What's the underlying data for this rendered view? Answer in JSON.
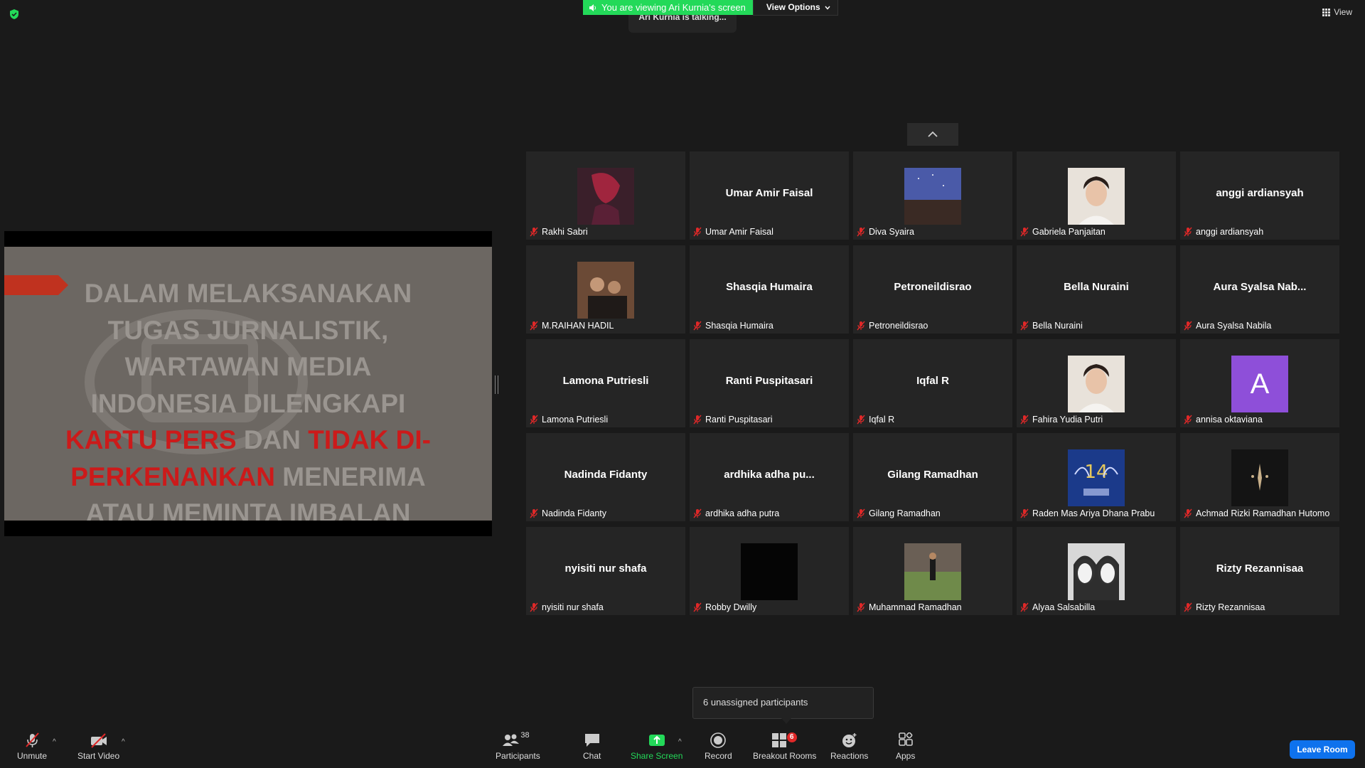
{
  "top": {
    "viewing_banner": "You are viewing Ari Kurnia's screen",
    "view_options": "View Options",
    "talking": "Ari Kurnia is talking...",
    "view_label": "View"
  },
  "slide": {
    "line1": "DALAM MELAKSANAKAN",
    "line2": "TUGAS JURNALISTIK,",
    "line3": "WARTAWAN MEDIA",
    "line4": "INDONESIA DILENGKAPI",
    "line5_red1": "KARTU PERS",
    "line5_gray": " DAN ",
    "line5_red2": "TIDAK DI-",
    "line6_red": "PERKENANKAN",
    "line6_gray": " MENERIMA",
    "line7": "ATAU MEMINTA IMBALAN"
  },
  "participants": [
    {
      "label": "Rakhi Sabri",
      "big": "",
      "avatar": "photo-dark-red"
    },
    {
      "label": "Umar Amir Faisal",
      "big": "Umar Amir Faisal",
      "avatar": ""
    },
    {
      "label": "Diva Syaira",
      "big": "",
      "avatar": "photo-night-sky"
    },
    {
      "label": "Gabriela Panjaitan",
      "big": "",
      "avatar": "photo-portrait"
    },
    {
      "label": "anggi ardiansyah",
      "big": "anggi ardiansyah",
      "avatar": ""
    },
    {
      "label": "M.RAIHAN HADIL",
      "big": "",
      "avatar": "photo-group"
    },
    {
      "label": "Shasqia Humaira",
      "big": "Shasqia Humaira",
      "avatar": ""
    },
    {
      "label": "Petroneildisrao",
      "big": "Petroneildisrao",
      "avatar": ""
    },
    {
      "label": "Bella Nuraini",
      "big": "Bella Nuraini",
      "avatar": ""
    },
    {
      "label": "Aura Syalsa Nabila",
      "big": "Aura Syalsa Nab...",
      "avatar": ""
    },
    {
      "label": "Lamona Putriesli",
      "big": "Lamona Putriesli",
      "avatar": ""
    },
    {
      "label": "Ranti Puspitasari",
      "big": "Ranti Puspitasari",
      "avatar": ""
    },
    {
      "label": "Iqfal R",
      "big": "Iqfal R",
      "avatar": ""
    },
    {
      "label": "Fahira Yudia Putri",
      "big": "",
      "avatar": "photo-portrait"
    },
    {
      "label": "annisa oktaviana",
      "big": "",
      "avatar": "letter",
      "letter": "A"
    },
    {
      "label": "Nadinda Fidanty",
      "big": "Nadinda Fidanty",
      "avatar": ""
    },
    {
      "label": "ardhika adha putra",
      "big": "ardhika  adha  pu...",
      "avatar": ""
    },
    {
      "label": "Gilang Ramadhan",
      "big": "Gilang Ramadhan",
      "avatar": ""
    },
    {
      "label": "Raden Mas Ariya Dhana Prabu",
      "big": "",
      "avatar": "photo-zoom-player"
    },
    {
      "label": "Achmad Rizki Ramadhan Hutomo",
      "big": "",
      "avatar": "photo-dark-logo"
    },
    {
      "label": "nyisiti nur shafa",
      "big": "nyisiti nur shafa",
      "avatar": ""
    },
    {
      "label": "Robby Dwilly",
      "big": "",
      "avatar": "photo-black"
    },
    {
      "label": "Muhammad Ramadhan",
      "big": "",
      "avatar": "photo-stadium"
    },
    {
      "label": "Alyaa Salsabilla",
      "big": "",
      "avatar": "photo-two-faces"
    },
    {
      "label": "Rizty Rezannisaa",
      "big": "Rizty Rezannisaa",
      "avatar": ""
    }
  ],
  "popup": {
    "text": "6 unassigned participants"
  },
  "toolbar": {
    "unmute": "Unmute",
    "start_video": "Start Video",
    "participants": "Participants",
    "participants_count": "38",
    "chat": "Chat",
    "share_screen": "Share Screen",
    "record": "Record",
    "breakout_rooms": "Breakout Rooms",
    "breakout_count": "6",
    "reactions": "Reactions",
    "apps": "Apps",
    "leave_room": "Leave Room"
  },
  "colors": {
    "accent_green": "#23d959",
    "leave_blue": "#0e72ed",
    "muted_red": "#e02828",
    "letter_avatar": "#8e4fd9"
  }
}
